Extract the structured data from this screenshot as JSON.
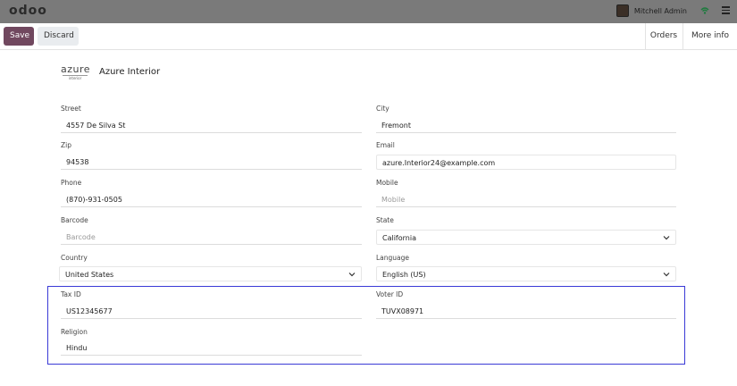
{
  "navbar": {
    "logo": "odoo",
    "user_name": "Mitchell Admin"
  },
  "toolbar": {
    "save_label": "Save",
    "discard_label": "Discard",
    "orders_label": "Orders",
    "more_info_label": "More info"
  },
  "partner": {
    "logo_text": "azure",
    "logo_subtext": "interior",
    "name": "Azure Interior"
  },
  "fields": {
    "street": {
      "label": "Street",
      "value": "4557 De Silva St"
    },
    "city": {
      "label": "City",
      "value": "Fremont"
    },
    "zip": {
      "label": "Zip",
      "value": "94538"
    },
    "email": {
      "label": "Email",
      "value": "azure.Interior24@example.com"
    },
    "phone": {
      "label": "Phone",
      "value": "(870)-931-0505"
    },
    "mobile": {
      "label": "Mobile",
      "placeholder": "Mobile"
    },
    "barcode": {
      "label": "Barcode",
      "placeholder": "Barcode"
    },
    "state": {
      "label": "State",
      "value": "California"
    },
    "country": {
      "label": "Country",
      "value": "United States"
    },
    "language": {
      "label": "Language",
      "value": "English (US)"
    },
    "tax_id": {
      "label": "Tax ID",
      "value": "US12345677"
    },
    "voter_id": {
      "label": "Voter ID",
      "value": "TUVX08971"
    },
    "religion": {
      "label": "Religion",
      "value": "Hindu"
    }
  },
  "colors": {
    "primary": "#71485f",
    "navbar": "#7a7a7a",
    "highlight": "#3a3ad6"
  }
}
